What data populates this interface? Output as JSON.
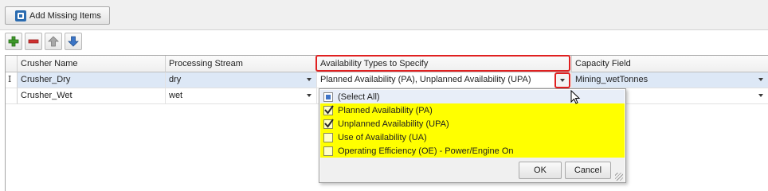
{
  "toolbar": {
    "add_missing_label": "Add Missing Items"
  },
  "icons": [
    "add-row-icon",
    "remove-row-icon",
    "move-up-icon",
    "move-down-icon"
  ],
  "grid": {
    "columns": [
      "Crusher Name",
      "Processing Stream",
      "Availability Types to Specify",
      "Capacity Field"
    ],
    "rows": [
      {
        "crusher": "Crusher_Dry",
        "stream": "dry",
        "availability": "Planned Availability (PA), Unplanned Availability (UPA)",
        "capacity": "Mining_wetTonnes",
        "indicator": "I"
      },
      {
        "crusher": "Crusher_Wet",
        "stream": "wet",
        "availability": "",
        "capacity": ""
      }
    ]
  },
  "dropdown": {
    "select_all": "(Select All)",
    "options": [
      {
        "label": "Planned Availability (PA)",
        "checked": true
      },
      {
        "label": "Unplanned Availability (UPA)",
        "checked": true
      },
      {
        "label": "Use of Availability (UA)",
        "checked": false
      },
      {
        "label": "Operating Efficiency (OE) - Power/Engine On",
        "checked": false
      }
    ],
    "ok_label": "OK",
    "cancel_label": "Cancel"
  },
  "colors": {
    "highlight": "#ffff00",
    "annotation_red": "#e02020",
    "selected_row": "#dde8f6"
  }
}
